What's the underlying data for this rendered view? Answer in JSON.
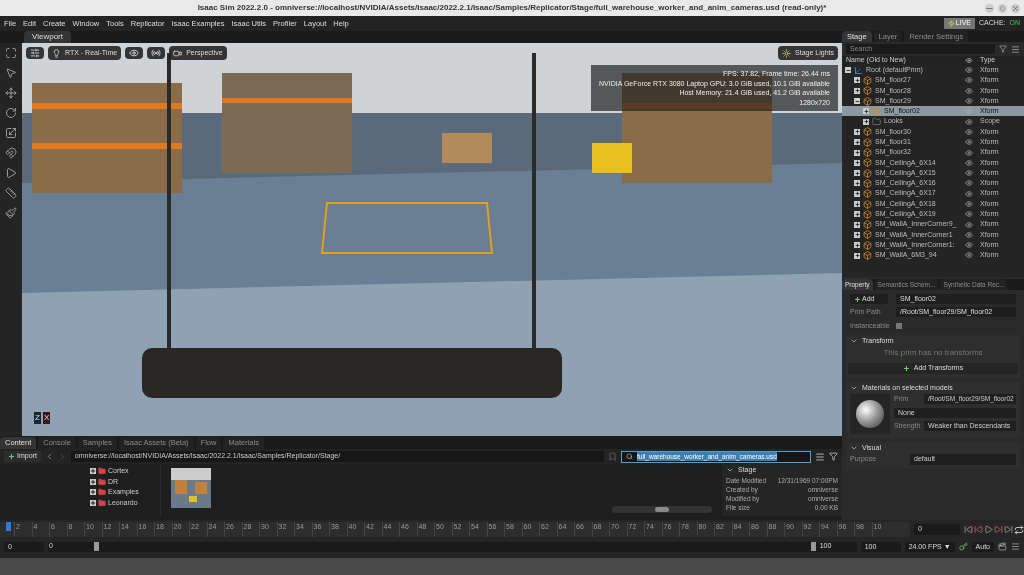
{
  "window": {
    "title": "Isaac Sim 2022.2.0 - omniverse://localhost/NVIDIA/Assets/Isaac/2022.2.1/Isaac/Samples/Replicator/Stage/full_warehouse_worker_and_anim_cameras.usd (read-only)*"
  },
  "menu": [
    "File",
    "Edit",
    "Create",
    "Window",
    "Tools",
    "Replicator",
    "Isaac Examples",
    "Isaac Utils",
    "Profiler",
    "Layout",
    "Help"
  ],
  "live": {
    "label": "LIVE",
    "cache_label": "CACHE:",
    "cache_value": "ON"
  },
  "viewport": {
    "tab": "Viewport",
    "render_mode": "RTX - Real-Time",
    "camera": "Perspective",
    "lights": "Stage Lights",
    "stats": [
      "FPS: 37.82, Frame time: 26.44 ms",
      "NVIDIA GeForce RTX 3080 Laptop GPU: 3.0 GiB used, 10.1 GiB available",
      "Host Memory: 21.4 GiB used, 41.2 GiB available",
      "1280x720"
    ],
    "axes": [
      "Z",
      "X"
    ]
  },
  "stage": {
    "tabs": [
      {
        "label": "Stage",
        "selected": true
      },
      {
        "label": "Layer",
        "selected": false
      },
      {
        "label": "Render Settings",
        "selected": false
      }
    ],
    "search": {
      "placeholder": "Search"
    },
    "columns": [
      "Name (Old to New)",
      "Type"
    ],
    "tree": [
      {
        "name": "Root (defaultPrim)",
        "type": "Xform",
        "kind": "root",
        "expanded": true,
        "selected": false,
        "children": [
          {
            "name": "SM_floor27",
            "type": "Xform",
            "kind": "mesh",
            "expanded": false,
            "selected": false
          },
          {
            "name": "SM_floor28",
            "type": "Xform",
            "kind": "mesh",
            "expanded": false,
            "selected": false
          },
          {
            "name": "SM_floor29",
            "type": "Xform",
            "kind": "mesh",
            "expanded": true,
            "selected": false,
            "children": [
              {
                "name": "SM_floor02",
                "type": "Xform",
                "kind": "mesh",
                "expanded": false,
                "selected": true
              },
              {
                "name": "Looks",
                "type": "Scope",
                "kind": "folder",
                "expanded": false,
                "selected": false
              }
            ]
          },
          {
            "name": "SM_floor30",
            "type": "Xform",
            "kind": "mesh",
            "expanded": false,
            "selected": false
          },
          {
            "name": "SM_floor31",
            "type": "Xform",
            "kind": "mesh",
            "expanded": false,
            "selected": false
          },
          {
            "name": "SM_floor32",
            "type": "Xform",
            "kind": "mesh",
            "expanded": false,
            "selected": false
          },
          {
            "name": "SM_CeilingA_6X14",
            "type": "Xform",
            "kind": "mesh",
            "expanded": false,
            "selected": false
          },
          {
            "name": "SM_CeilingA_6X15",
            "type": "Xform",
            "kind": "mesh",
            "expanded": false,
            "selected": false
          },
          {
            "name": "SM_CeilingA_6X16",
            "type": "Xform",
            "kind": "mesh",
            "expanded": false,
            "selected": false
          },
          {
            "name": "SM_CeilingA_6X17",
            "type": "Xform",
            "kind": "mesh",
            "expanded": false,
            "selected": false
          },
          {
            "name": "SM_CeilingA_6X18",
            "type": "Xform",
            "kind": "mesh",
            "expanded": false,
            "selected": false
          },
          {
            "name": "SM_CeilingA_6X19",
            "type": "Xform",
            "kind": "mesh",
            "expanded": false,
            "selected": false
          },
          {
            "name": "SM_WallA_InnerCorner9_",
            "type": "Xform",
            "kind": "mesh",
            "expanded": false,
            "selected": false
          },
          {
            "name": "SM_WallA_InnerCorner1",
            "type": "Xform",
            "kind": "mesh",
            "expanded": false,
            "selected": false
          },
          {
            "name": "SM_WallA_InnerCorner1:",
            "type": "Xform",
            "kind": "mesh",
            "expanded": false,
            "selected": false
          },
          {
            "name": "SM_WallA_6M3_94",
            "type": "Xform",
            "kind": "mesh",
            "expanded": false,
            "selected": false
          }
        ]
      }
    ]
  },
  "property": {
    "tabs": [
      {
        "label": "Property",
        "selected": true
      },
      {
        "label": "Semantics Schem...",
        "selected": false
      },
      {
        "label": "Synthetic Data Rec...",
        "selected": false
      }
    ],
    "add_button": "Add",
    "name_value": "SM_floor02",
    "prim_path_label": "Prim Path",
    "prim_path": "/Root/SM_floor29/SM_floor02",
    "instanceable_label": "Instanceable",
    "instanceable": false,
    "sections": [
      {
        "kind": "transform",
        "title": "Transform",
        "expanded": true,
        "message": "This prim has no transforms",
        "button": "Add Transforms"
      },
      {
        "kind": "materials",
        "title": "Materials on selected models",
        "expanded": true,
        "prim_label": "Prim",
        "prim_value": "/Root/SM_floor29/SM_floor02",
        "material": "None",
        "strength_label": "Strength",
        "strength_value": "Weaker than Descendants"
      },
      {
        "kind": "visual",
        "title": "Visual",
        "expanded": true,
        "purpose_label": "Purpose",
        "purpose_value": "default"
      }
    ]
  },
  "content": {
    "tabs": [
      {
        "label": "Content",
        "selected": true
      },
      {
        "label": "Console",
        "selected": false
      },
      {
        "label": "Samples",
        "selected": false
      },
      {
        "label": "Isaac Assets (Beta)",
        "selected": false
      },
      {
        "label": "Flow",
        "selected": false
      },
      {
        "label": "Materials",
        "selected": false
      }
    ],
    "import_button": "Import",
    "path": "omniverse://localhost/NVIDIA/Assets/Isaac/2022.2.1/Isaac/Samples/Replicator/Stage/",
    "search_value": "full_warehouse_worker_and_anim_cameras.usd",
    "folders": [
      "Cortex",
      "DR",
      "Examples",
      "Leonardo"
    ],
    "details": {
      "title": "Stage",
      "rows": [
        {
          "label": "Date Modified",
          "value": "12/31/1969 07:00PM"
        },
        {
          "label": "Created by",
          "value": "omniverse"
        },
        {
          "label": "Modified by",
          "value": "omniverse"
        },
        {
          "label": "File size",
          "value": "0.00 KB"
        }
      ]
    }
  },
  "timeline": {
    "ticks": [
      "2",
      "4",
      "6",
      "8",
      "10",
      "12",
      "14",
      "16",
      "18",
      "20",
      "22",
      "24",
      "26",
      "28",
      "30",
      "32",
      "34",
      "36",
      "38",
      "40",
      "42",
      "44",
      "46",
      "48",
      "50",
      "52",
      "54",
      "56",
      "58",
      "60",
      "62",
      "64",
      "66",
      "68",
      "70",
      "72",
      "74",
      "76",
      "78",
      "80",
      "82",
      "84",
      "86",
      "88",
      "90",
      "92",
      "94",
      "96",
      "98",
      "10"
    ],
    "current_frame": "0",
    "start": "0",
    "range_start": "0",
    "range_end": "100",
    "end": "100",
    "fps": "24.00 FPS ▼",
    "auto": "Auto"
  }
}
